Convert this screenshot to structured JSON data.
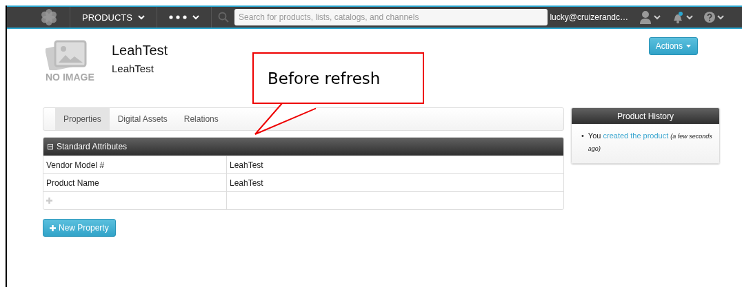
{
  "navbar": {
    "menu_label": "PRODUCTS",
    "search": {
      "placeholder": "Search for products, lists, catalogs, and channels"
    },
    "user_email": "lucky@cruizerandc…",
    "notifications_unread": true
  },
  "product": {
    "image_caption": "NO IMAGE",
    "title": "LeahTest",
    "subtitle": "LeahTest"
  },
  "actions_button": "Actions",
  "callout": "Before refresh",
  "tabs": [
    {
      "label": "Properties",
      "selected": true
    },
    {
      "label": "Digital Assets",
      "selected": false
    },
    {
      "label": "Relations",
      "selected": false
    }
  ],
  "attributes": {
    "toggle": "⊟",
    "title": "Standard Attributes",
    "rows": [
      {
        "name": "Vendor Model #",
        "value": "LeahTest"
      },
      {
        "name": "Product Name",
        "value": "LeahTest"
      }
    ]
  },
  "new_property_button": "New Property",
  "history": {
    "title": "Product History",
    "items": [
      {
        "bullet": "•",
        "actor": "You",
        "action": "created the product",
        "time": "(a few seconds ago)"
      }
    ]
  }
}
